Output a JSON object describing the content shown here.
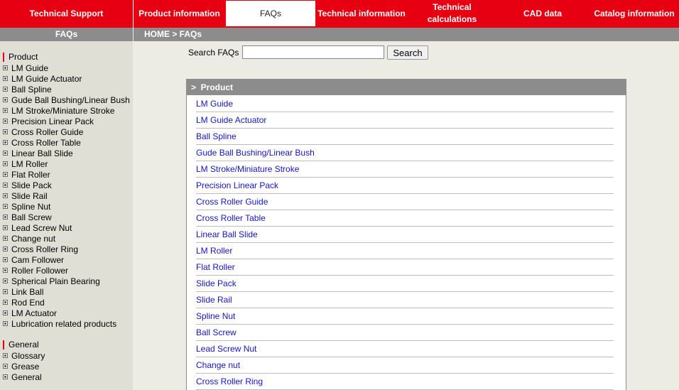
{
  "topnav": {
    "items": [
      {
        "label": "Technical Support"
      },
      {
        "label": "Product information"
      },
      {
        "label": "FAQs",
        "active": true
      },
      {
        "label": "Technical information"
      },
      {
        "label": "Technical\ncalculations"
      },
      {
        "label": "CAD data"
      },
      {
        "label": "Catalog information"
      }
    ]
  },
  "left_header": "FAQs",
  "breadcrumb": "HOME > FAQs",
  "sidebar": {
    "sections": [
      {
        "title": "Product",
        "items": [
          "LM Guide",
          "LM Guide Actuator",
          "Ball Spline",
          "Gude Ball Bushing/Linear Bush",
          "LM Stroke/Miniature Stroke",
          "Precision Linear Pack",
          "Cross Roller Guide",
          "Cross Roller Table",
          "Linear Ball Slide",
          "LM Roller",
          "Flat Roller",
          "Slide Pack",
          "Slide Rail",
          "Spline Nut",
          "Ball Screw",
          "Lead Screw Nut",
          "Change nut",
          "Cross Roller Ring",
          "Cam Follower",
          "Roller Follower",
          "Spherical Plain Bearing",
          "Link Ball",
          "Rod End",
          "LM Actuator",
          "Lubrication related products"
        ]
      },
      {
        "title": "General",
        "items": [
          "Glossary",
          "Grease",
          "General"
        ]
      }
    ]
  },
  "search": {
    "label": "Search FAQs",
    "value": "",
    "button": "Search"
  },
  "panel": {
    "title": ">  Product",
    "items": [
      "LM Guide",
      "LM Guide Actuator",
      "Ball Spline",
      "Gude Ball Bushing/Linear Bush",
      "LM Stroke/Miniature Stroke",
      "Precision Linear Pack",
      "Cross Roller Guide",
      "Cross Roller Table",
      "Linear Ball Slide",
      "LM Roller",
      "Flat Roller",
      "Slide Pack",
      "Slide Rail",
      "Spline Nut",
      "Ball Screw",
      "Lead Screw Nut",
      "Change nut",
      "Cross Roller Ring"
    ]
  },
  "colors": {
    "brand_red": "#e60012",
    "bar_gray": "#8c8c8c",
    "link_blue": "#1515c4"
  }
}
